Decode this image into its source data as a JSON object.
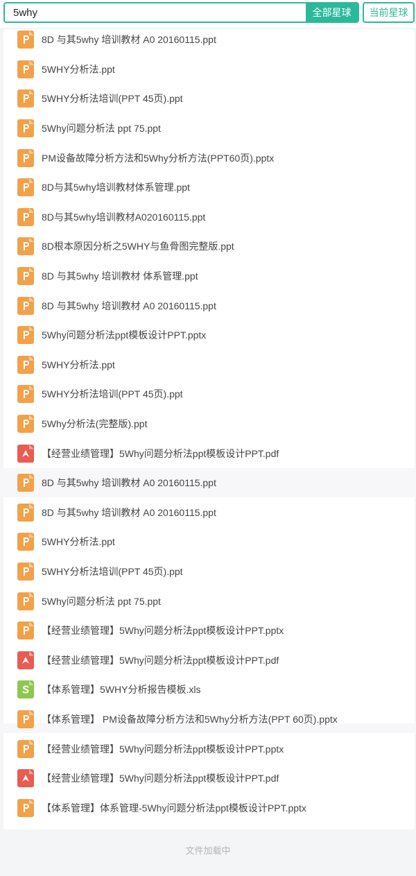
{
  "search": {
    "value": "5why",
    "all_button": "全部星球",
    "current_button": "当前星球"
  },
  "files": [
    {
      "name": "8D 与其5why 培训教材 A0 20160115.ppt",
      "type": "ppt"
    },
    {
      "name": "5WHY分析法.ppt",
      "type": "ppt"
    },
    {
      "name": "5WHY分析法培训(PPT 45页).ppt",
      "type": "ppt"
    },
    {
      "name": "5Why问题分析法 ppt 75.ppt",
      "type": "ppt"
    },
    {
      "name": "PM设备故障分析方法和5Why分析方法(PPT60页).pptx",
      "type": "ppt"
    },
    {
      "name": "8D与其5why培训教材体系管理.ppt",
      "type": "ppt"
    },
    {
      "name": "8D与其5why培训教材A020160115.ppt",
      "type": "ppt"
    },
    {
      "name": "8D根本原因分析之5WHY与鱼骨图完整版.ppt",
      "type": "ppt"
    },
    {
      "name": "8D 与其5why 培训教材 体系管理.ppt",
      "type": "ppt"
    },
    {
      "name": "8D 与其5why 培训教材 A0 20160115.ppt",
      "type": "ppt"
    },
    {
      "name": "5Why问题分析法ppt模板设计PPT.pptx",
      "type": "ppt"
    },
    {
      "name": "5WHY分析法.ppt",
      "type": "ppt"
    },
    {
      "name": "5WHY分析法培训(PPT 45页).ppt",
      "type": "ppt"
    },
    {
      "name": "5Why分析法(完整版).ppt",
      "type": "ppt"
    },
    {
      "name": "【经营业绩管理】5Why问题分析法ppt模板设计PPT.pdf",
      "type": "pdf"
    },
    {
      "name": "8D 与其5why 培训教材 A0 20160115.ppt",
      "type": "ppt"
    },
    {
      "name": "8D 与其5why 培训教材 A0 20160115.ppt",
      "type": "ppt"
    },
    {
      "name": "5WHY分析法.ppt",
      "type": "ppt"
    },
    {
      "name": "5WHY分析法培训(PPT 45页).ppt",
      "type": "ppt"
    },
    {
      "name": "5Why问题分析法 ppt 75.ppt",
      "type": "ppt"
    },
    {
      "name": "【经营业绩管理】5Why问题分析法ppt模板设计PPT.pptx",
      "type": "ppt"
    },
    {
      "name": "【经营业绩管理】5Why问题分析法ppt模板设计PPT.pdf",
      "type": "pdf"
    },
    {
      "name": "【体系管理】5WHY分析报告模板.xls",
      "type": "xls"
    },
    {
      "name": "【体系管理】 PM设备故障分析方法和5Why分析方法(PPT 60页).pptx",
      "type": "ppt"
    },
    {
      "name": "【经营业绩管理】5Why问题分析法ppt模板设计PPT.pptx",
      "type": "ppt"
    },
    {
      "name": "【经营业绩管理】5Why问题分析法ppt模板设计PPT.pdf",
      "type": "pdf"
    },
    {
      "name": "【体系管理】体系管理-5Why问题分析法ppt模板设计PPT.pptx",
      "type": "ppt"
    }
  ],
  "loading_text": "文件加载中",
  "colors": {
    "accent": "#2bb99a",
    "ppt": "#f2a14a",
    "pdf": "#ea5b52",
    "xls": "#8cc84b"
  }
}
